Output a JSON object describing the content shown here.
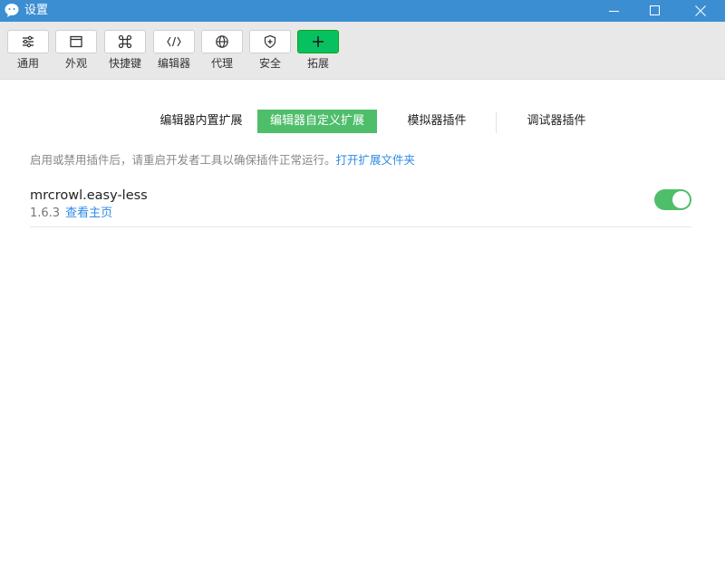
{
  "window": {
    "title": "设置",
    "icon": "wechat-bubble-icon",
    "controls": [
      "minimize-icon",
      "maximize-icon",
      "close-icon"
    ]
  },
  "toolbar": {
    "items": [
      {
        "label": "通用",
        "icon": "sliders-icon",
        "active": false
      },
      {
        "label": "外观",
        "icon": "window-icon",
        "active": false
      },
      {
        "label": "快捷键",
        "icon": "command-key-icon",
        "active": false
      },
      {
        "label": "编辑器",
        "icon": "code-icon",
        "active": false
      },
      {
        "label": "代理",
        "icon": "globe-icon",
        "active": false
      },
      {
        "label": "安全",
        "icon": "shield-icon",
        "active": false
      },
      {
        "label": "拓展",
        "icon": "plus-icon",
        "active": true
      }
    ]
  },
  "tabs": [
    {
      "label": "编辑器内置扩展",
      "active": false
    },
    {
      "label": "编辑器自定义扩展",
      "active": true
    },
    {
      "label": "模拟器插件",
      "active": false
    },
    {
      "label": "调试器插件",
      "active": false
    }
  ],
  "notice": {
    "text": "启用或禁用插件后，请重启开发者工具以确保插件正常运行。",
    "link": "打开扩展文件夹"
  },
  "extensions": [
    {
      "name": "mrcrowl.easy-less",
      "version": "1.6.3",
      "link": "查看主页",
      "enabled": true
    }
  ],
  "colors": {
    "titlebar": "#3c8ed3",
    "accent_green": "#4fbe6b",
    "active_tool": "#07c160",
    "link": "#2e8ae6"
  }
}
